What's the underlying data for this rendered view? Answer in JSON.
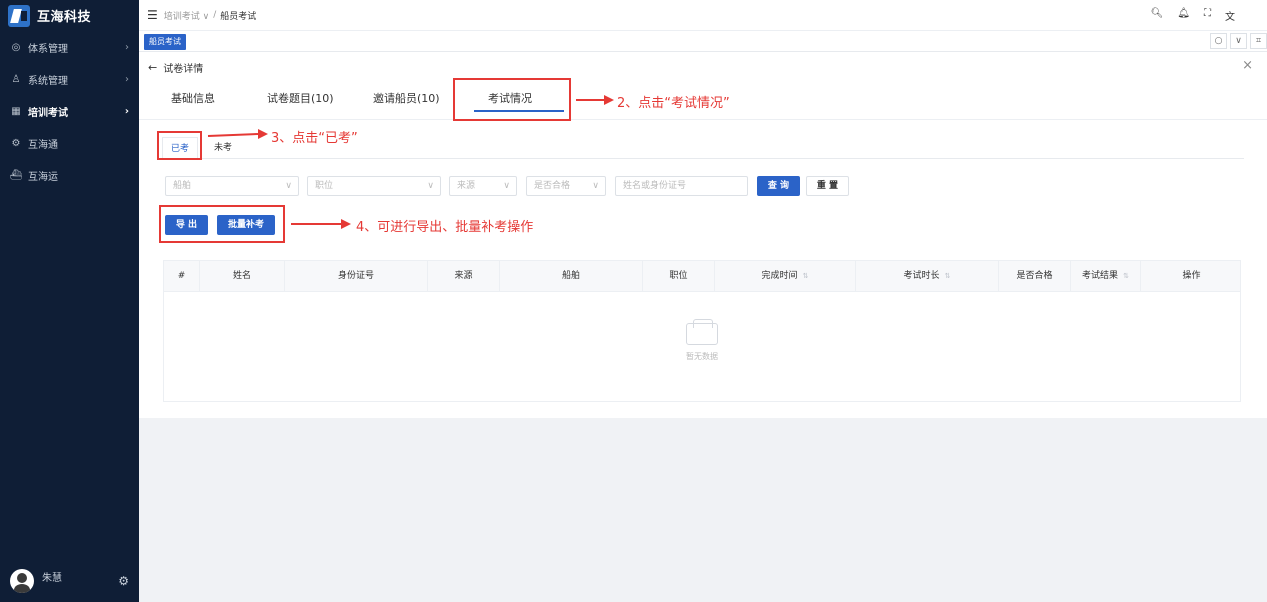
{
  "brand": {
    "name": "互海科技"
  },
  "sidebar": {
    "items": [
      {
        "label": "体系管理",
        "icon": "ism-icon",
        "glyph": "◎"
      },
      {
        "label": "系统管理",
        "icon": "user-icon",
        "glyph": "♙"
      },
      {
        "label": "培训考试",
        "icon": "grid-icon",
        "glyph": "▦"
      },
      {
        "label": "互海通",
        "icon": "settings-icon",
        "glyph": "⚙"
      },
      {
        "label": "互海运",
        "icon": "ship-icon",
        "glyph": "⛴"
      }
    ],
    "user": {
      "name": "朱慧"
    }
  },
  "header": {
    "breadcrumb_parent": "培训考试 ∨",
    "breadcrumb_separator": "/",
    "breadcrumb_current": "船员考试"
  },
  "tagbar": {
    "active_tag": "船员考试"
  },
  "panel": {
    "title": "试卷详情",
    "tabs": [
      "基础信息",
      "试卷题目(10)",
      "邀请船员(10)",
      "考试情况"
    ],
    "active_tab": "考试情况"
  },
  "subtabs": [
    "已考",
    "未考"
  ],
  "filters": {
    "ship_placeholder": "船舶",
    "position_placeholder": "职位",
    "source_placeholder": "来源",
    "qualified_placeholder": "是否合格",
    "search_placeholder": "姓名或身份证号",
    "query_label": "查 询",
    "reset_label": "重 置"
  },
  "actions": {
    "export_label": "导 出",
    "batch_label": "批量补考"
  },
  "table": {
    "columns": [
      "#",
      "姓名",
      "身份证号",
      "来源",
      "船舶",
      "职位",
      "完成时间",
      "考试时长",
      "是否合格",
      "考试结果",
      "操作"
    ],
    "rows": [],
    "empty_text": "暂无数据"
  },
  "annotations": {
    "step2": "2、点击“考试情况”",
    "step3": "3、点击“已考”",
    "step4": "4、可进行导出、批量补考操作",
    "color": "#e53935"
  }
}
